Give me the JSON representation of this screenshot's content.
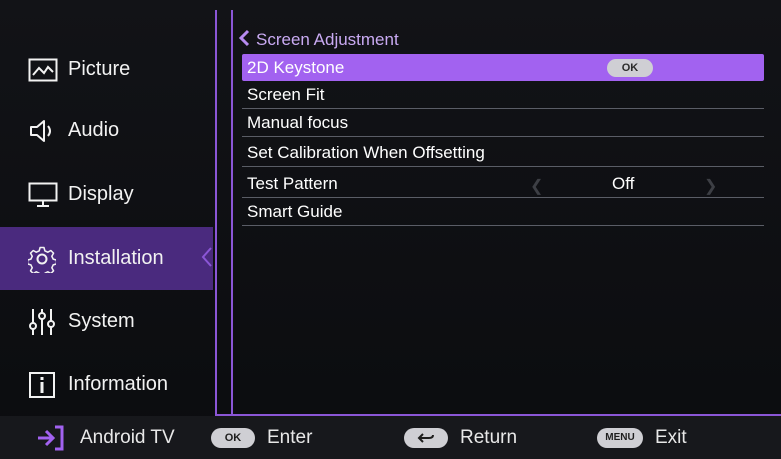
{
  "sidebar": {
    "items": [
      {
        "label": "Picture",
        "icon": "picture-icon"
      },
      {
        "label": "Audio",
        "icon": "speaker-icon"
      },
      {
        "label": "Display",
        "icon": "monitor-icon"
      },
      {
        "label": "Installation",
        "icon": "gear-icon",
        "active": true
      },
      {
        "label": "System",
        "icon": "sliders-icon"
      },
      {
        "label": "Information",
        "icon": "info-icon"
      }
    ]
  },
  "panel": {
    "breadcrumb": "Screen Adjustment",
    "rows": [
      {
        "label": "2D Keystone",
        "badge": "OK",
        "selected": true
      },
      {
        "label": "Screen Fit"
      },
      {
        "label": "Manual focus"
      },
      {
        "label": "Set Calibration When Offsetting"
      },
      {
        "label": "Test Pattern",
        "value": "Off"
      },
      {
        "label": "Smart Guide"
      }
    ]
  },
  "footer": {
    "source_label": "Android TV",
    "ok_key": "OK",
    "enter_label": "Enter",
    "return_label": "Return",
    "menu_key": "MENU",
    "exit_label": "Exit"
  },
  "colors": {
    "accent": "#a262f0",
    "sidebar_active": "#4a2a7e",
    "divider": "#8b56d6",
    "breadcrumb": "#c9aaf2"
  }
}
